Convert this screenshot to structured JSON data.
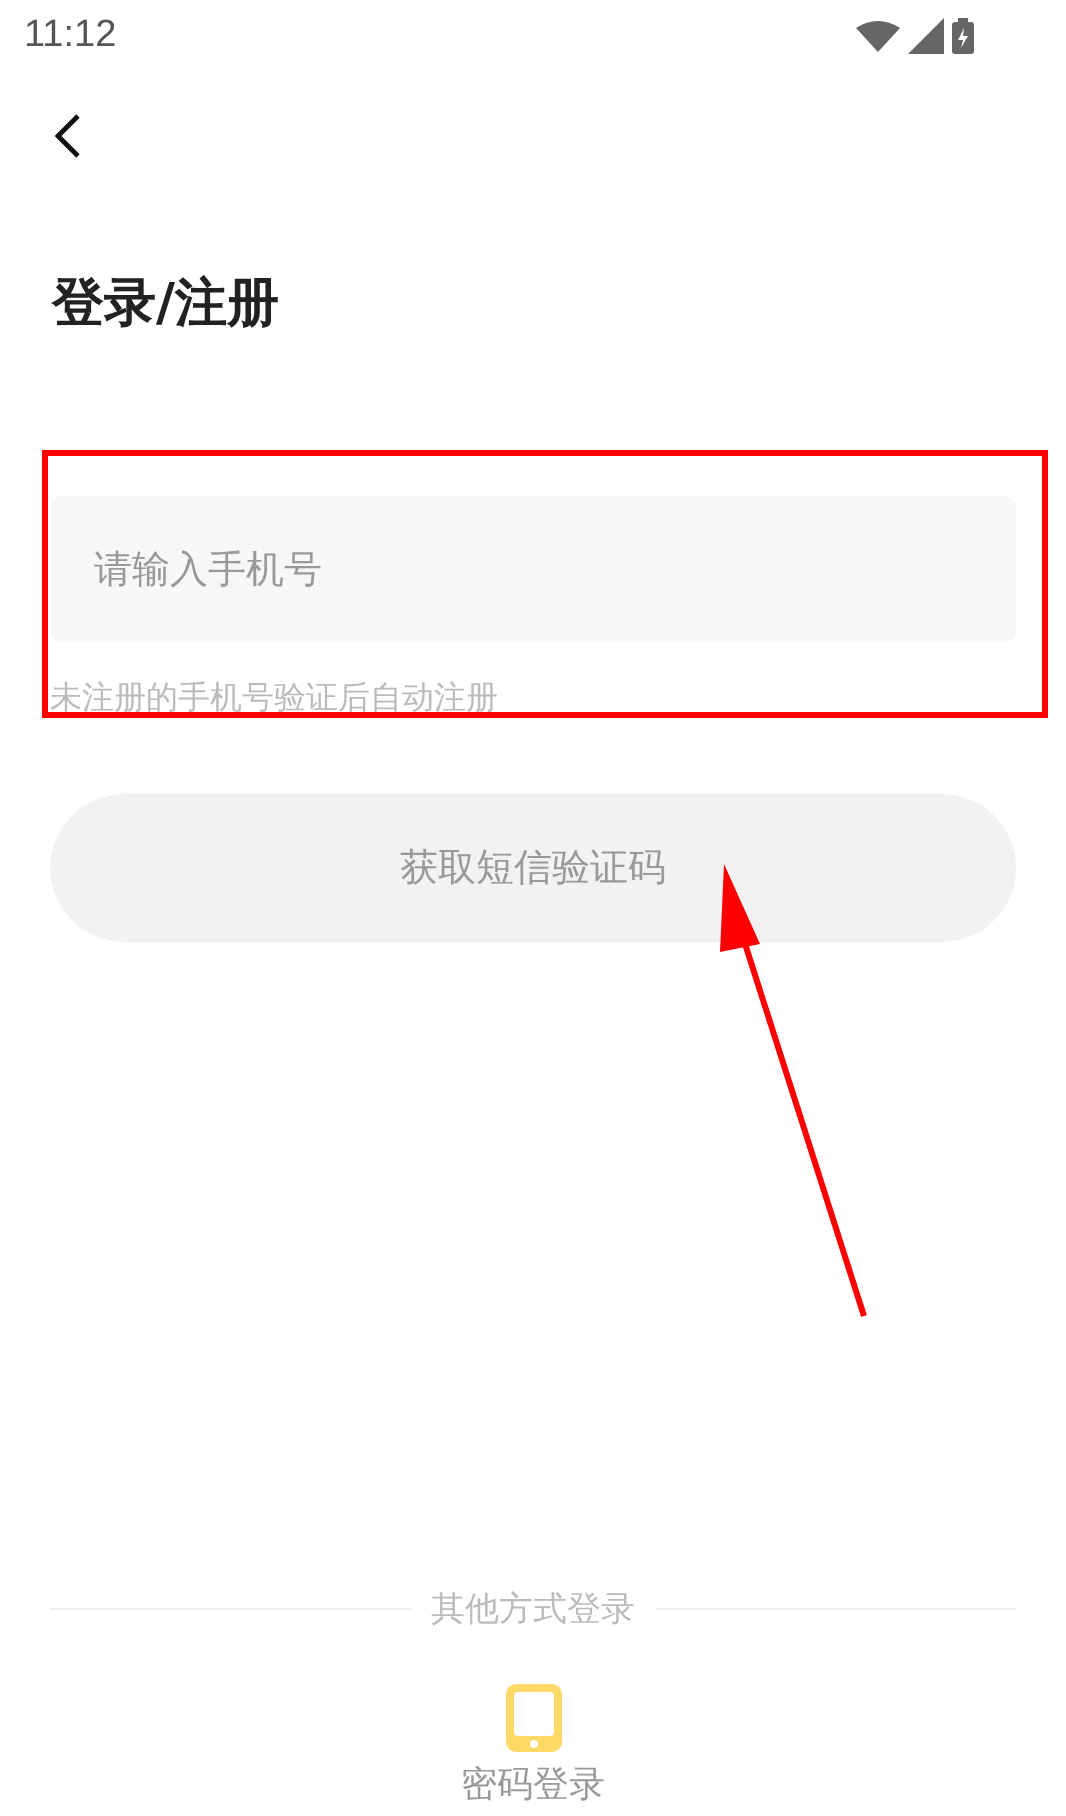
{
  "status_bar": {
    "time": "11:12"
  },
  "header": {
    "title": "登录/注册"
  },
  "phone_field": {
    "placeholder": "请输入手机号"
  },
  "hint": "未注册的手机号验证后自动注册",
  "sms_button": {
    "label": "获取短信验证码",
    "disabled": true
  },
  "other_login": {
    "divider_label": "其他方式登录",
    "options": [
      {
        "kind": "phone",
        "label": "密码登录"
      }
    ]
  },
  "annotations": {
    "highlight_box": true,
    "arrow": true
  }
}
